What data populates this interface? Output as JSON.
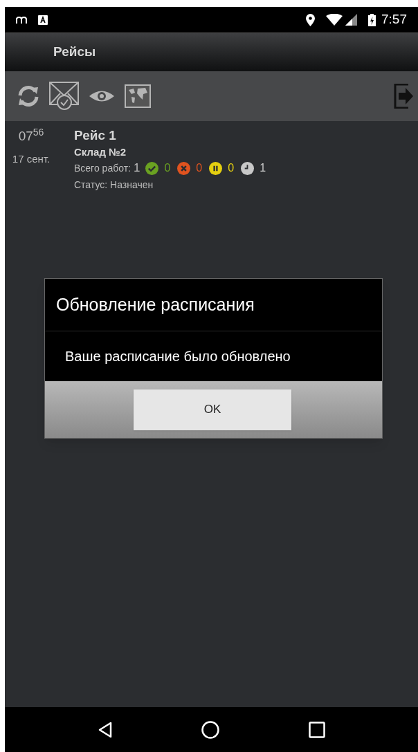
{
  "status_bar": {
    "time": "7:57"
  },
  "title_bar": {
    "title": "Рейсы"
  },
  "trips": [
    {
      "time_hour": "07",
      "time_minute": "56",
      "date": "17 сент.",
      "title": "Рейс 1",
      "warehouse": "Склад №2",
      "total_label": "Всего работ:",
      "total": "1",
      "counts": [
        {
          "kind": "done",
          "value": "0",
          "color": "#6aa121"
        },
        {
          "kind": "failed",
          "value": "0",
          "color": "#e0531f"
        },
        {
          "kind": "paused",
          "value": "0",
          "color": "#e5cf10"
        },
        {
          "kind": "pending",
          "value": "1",
          "color": "#c8c8c8"
        }
      ],
      "status": "Статус: Назначен"
    }
  ],
  "dialog": {
    "title": "Обновление расписания",
    "message": "Ваше расписание было обновлено",
    "button": "OK"
  }
}
